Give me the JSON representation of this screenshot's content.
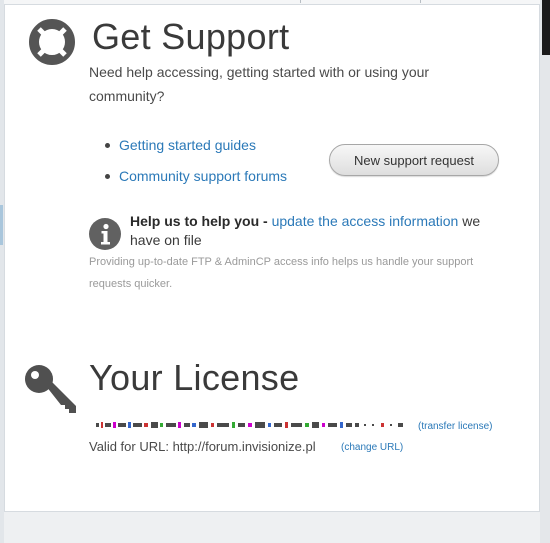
{
  "support": {
    "title": "Get Support",
    "intro": "Need help accessing, getting started with or using your community?",
    "links": [
      "Getting started guides",
      "Community support forums"
    ],
    "new_request_label": "New support request",
    "help_bold": "Help us to help you -",
    "help_link": "update the access information",
    "help_tail": "we have on file",
    "note": "Providing up-to-date FTP & AdminCP access info helps us handle your support requests quicker."
  },
  "license": {
    "title": "Your License",
    "transfer_label": "(transfer license)",
    "url_label": "Valid for URL: http://forum.invisionize.pl",
    "change_url_label": "(change URL)"
  },
  "icons": {
    "support": "lifebuoy-icon",
    "info": "info-icon",
    "license": "key-icon"
  },
  "colors": {
    "link": "#2b79b8",
    "heading": "#3a3a3a",
    "icon": "#555555"
  }
}
